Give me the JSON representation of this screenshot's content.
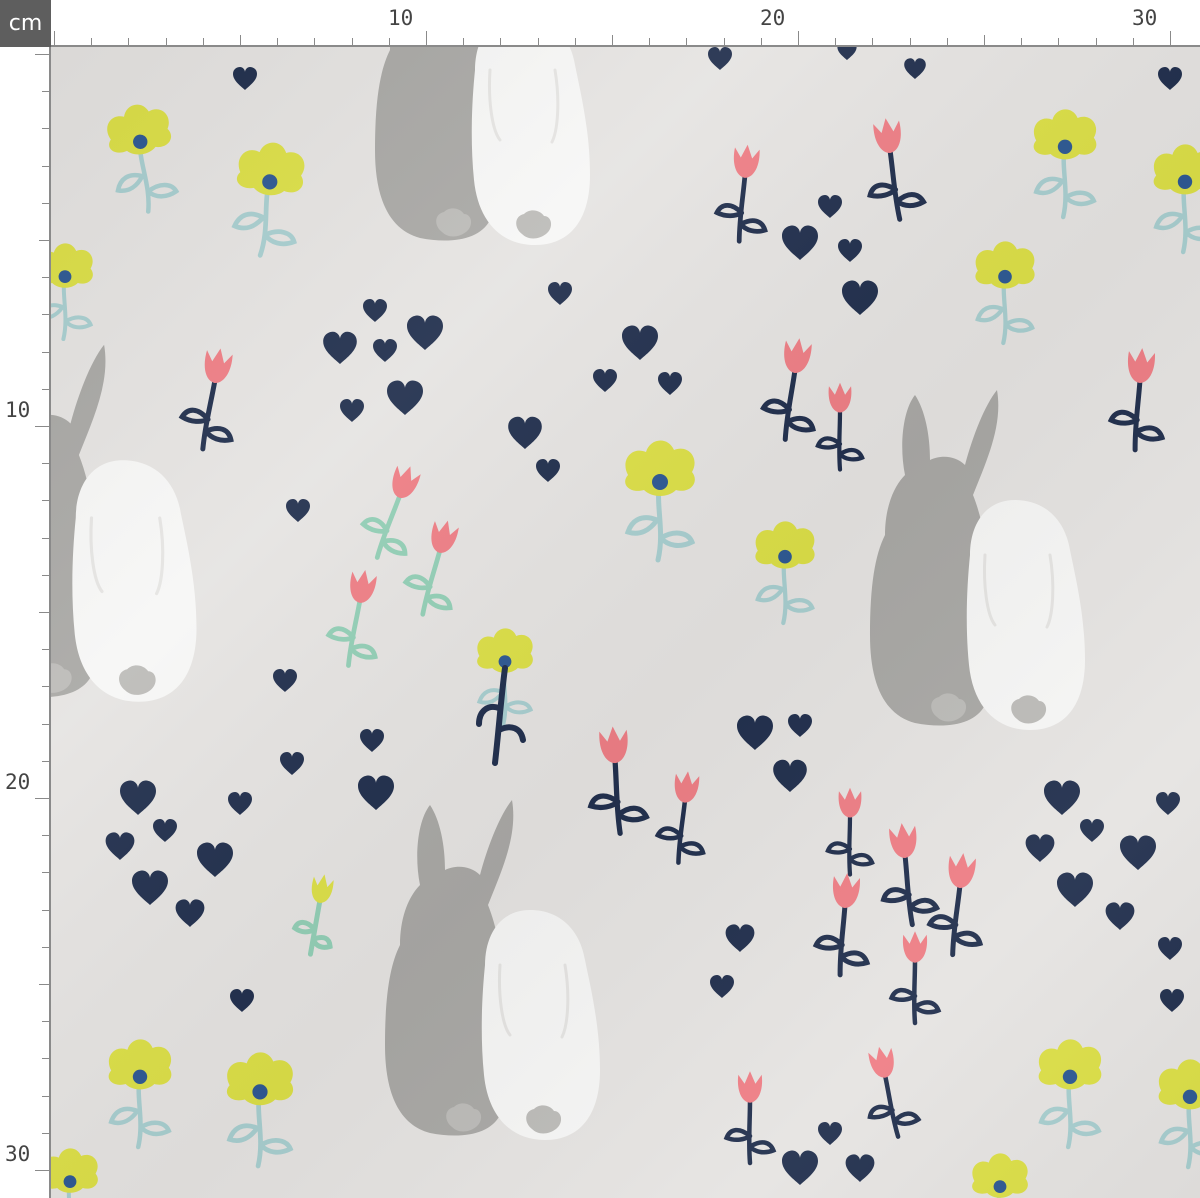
{
  "ruler": {
    "unit": "cm",
    "top_labels": [
      "10",
      "20",
      "30"
    ],
    "left_labels": [
      "10",
      "20",
      "30"
    ]
  },
  "fabric": {
    "colors": {
      "background": "#e6e4e2",
      "gray_bunny": "#aaa9a6",
      "white_bunny": "#f7f7f6",
      "tail": "#bdbcb9",
      "heart": "#22304e",
      "yellow_flower": "#dde048",
      "flower_center": "#2f5a94",
      "stem_blue": "#a9cfd0",
      "tulip_pink": "#ef7f86",
      "stem_navy": "#22304e",
      "stem_mint": "#93cfb6"
    },
    "motifs": [
      "bunny-pair",
      "yellow-flower",
      "pink-tulip",
      "navy-heart",
      "yellow-bud"
    ]
  }
}
